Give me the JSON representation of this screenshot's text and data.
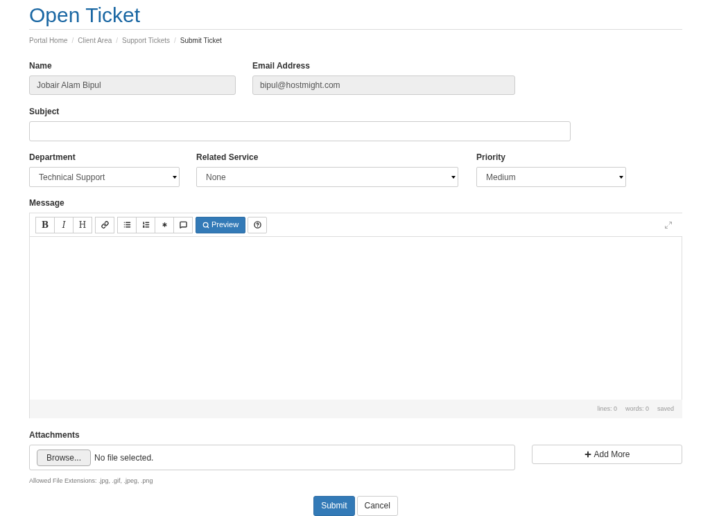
{
  "title": "Open Ticket",
  "breadcrumb_separator": "/",
  "breadcrumb": [
    {
      "label": "Portal Home",
      "selected": false
    },
    {
      "label": "Client Area",
      "selected": false
    },
    {
      "label": "Support Tickets",
      "selected": false
    },
    {
      "label": "Submit Ticket",
      "selected": true
    }
  ],
  "name": {
    "label": "Name",
    "value": "Jobair Alam Bipul"
  },
  "email": {
    "label": "Email Address",
    "value": "bipul@hostmight.com"
  },
  "subject": {
    "label": "Subject"
  },
  "selects": [
    {
      "label": "Department",
      "value": "Technical Support"
    },
    {
      "label": "Related Service",
      "value": "None"
    },
    {
      "label": "Priority",
      "value": "Medium"
    }
  ],
  "message": {
    "label": "Message",
    "format_buttons": [
      "B",
      "I",
      "H"
    ],
    "preview_button": "Preview",
    "status": [
      "lines: 0",
      "words: 0",
      "saved"
    ]
  },
  "attachments": {
    "label": "Attachments",
    "browse_button": "Browse...",
    "file_status": "No file selected.",
    "add_more": "Add More",
    "hint": "Allowed File Extensions: .jpg, .gif, .jpeg, .png"
  },
  "buttons": {
    "submit": "Submit",
    "cancel": "Cancel"
  }
}
